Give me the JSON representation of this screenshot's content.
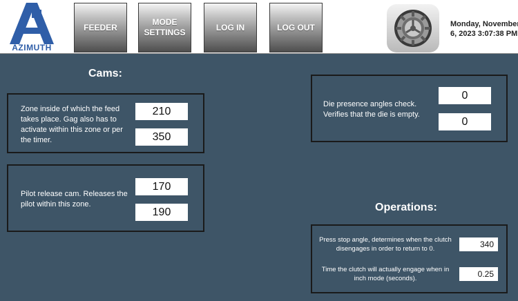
{
  "header": {
    "logo_text": "AZIMUTH",
    "buttons": [
      "FEEDER",
      "MODE\nSETTINGS",
      "LOG IN",
      "LOG OUT"
    ],
    "settings_icon": "gear-icon",
    "datetime_line1": "Monday, November",
    "datetime_line2": "6, 2023 3:07:38 PM"
  },
  "cams": {
    "title": "Cams:",
    "feed_zone": {
      "label": "Zone inside of which the feed takes place. Gag also has to activate within this zone or per the timer.",
      "start": "210",
      "end": "350"
    },
    "pilot_release": {
      "label": "Pilot release cam. Releases the pilot within this zone.",
      "start": "170",
      "end": "190"
    }
  },
  "die_presence": {
    "label": "Die presence angles check. Verifies that the die is empty.",
    "value1": "0",
    "value2": "0"
  },
  "operations": {
    "title": "Operations:",
    "stop_angle": {
      "label": "Press stop angle, determines when the clutch disengages in order to return to 0.",
      "value": "340"
    },
    "inch_time": {
      "label": "Time the clutch will actually engage when in inch mode (seconds).",
      "value": "0.25"
    }
  },
  "colors": {
    "background": "#3e5567",
    "logo_blue": "#2f5ea8"
  }
}
